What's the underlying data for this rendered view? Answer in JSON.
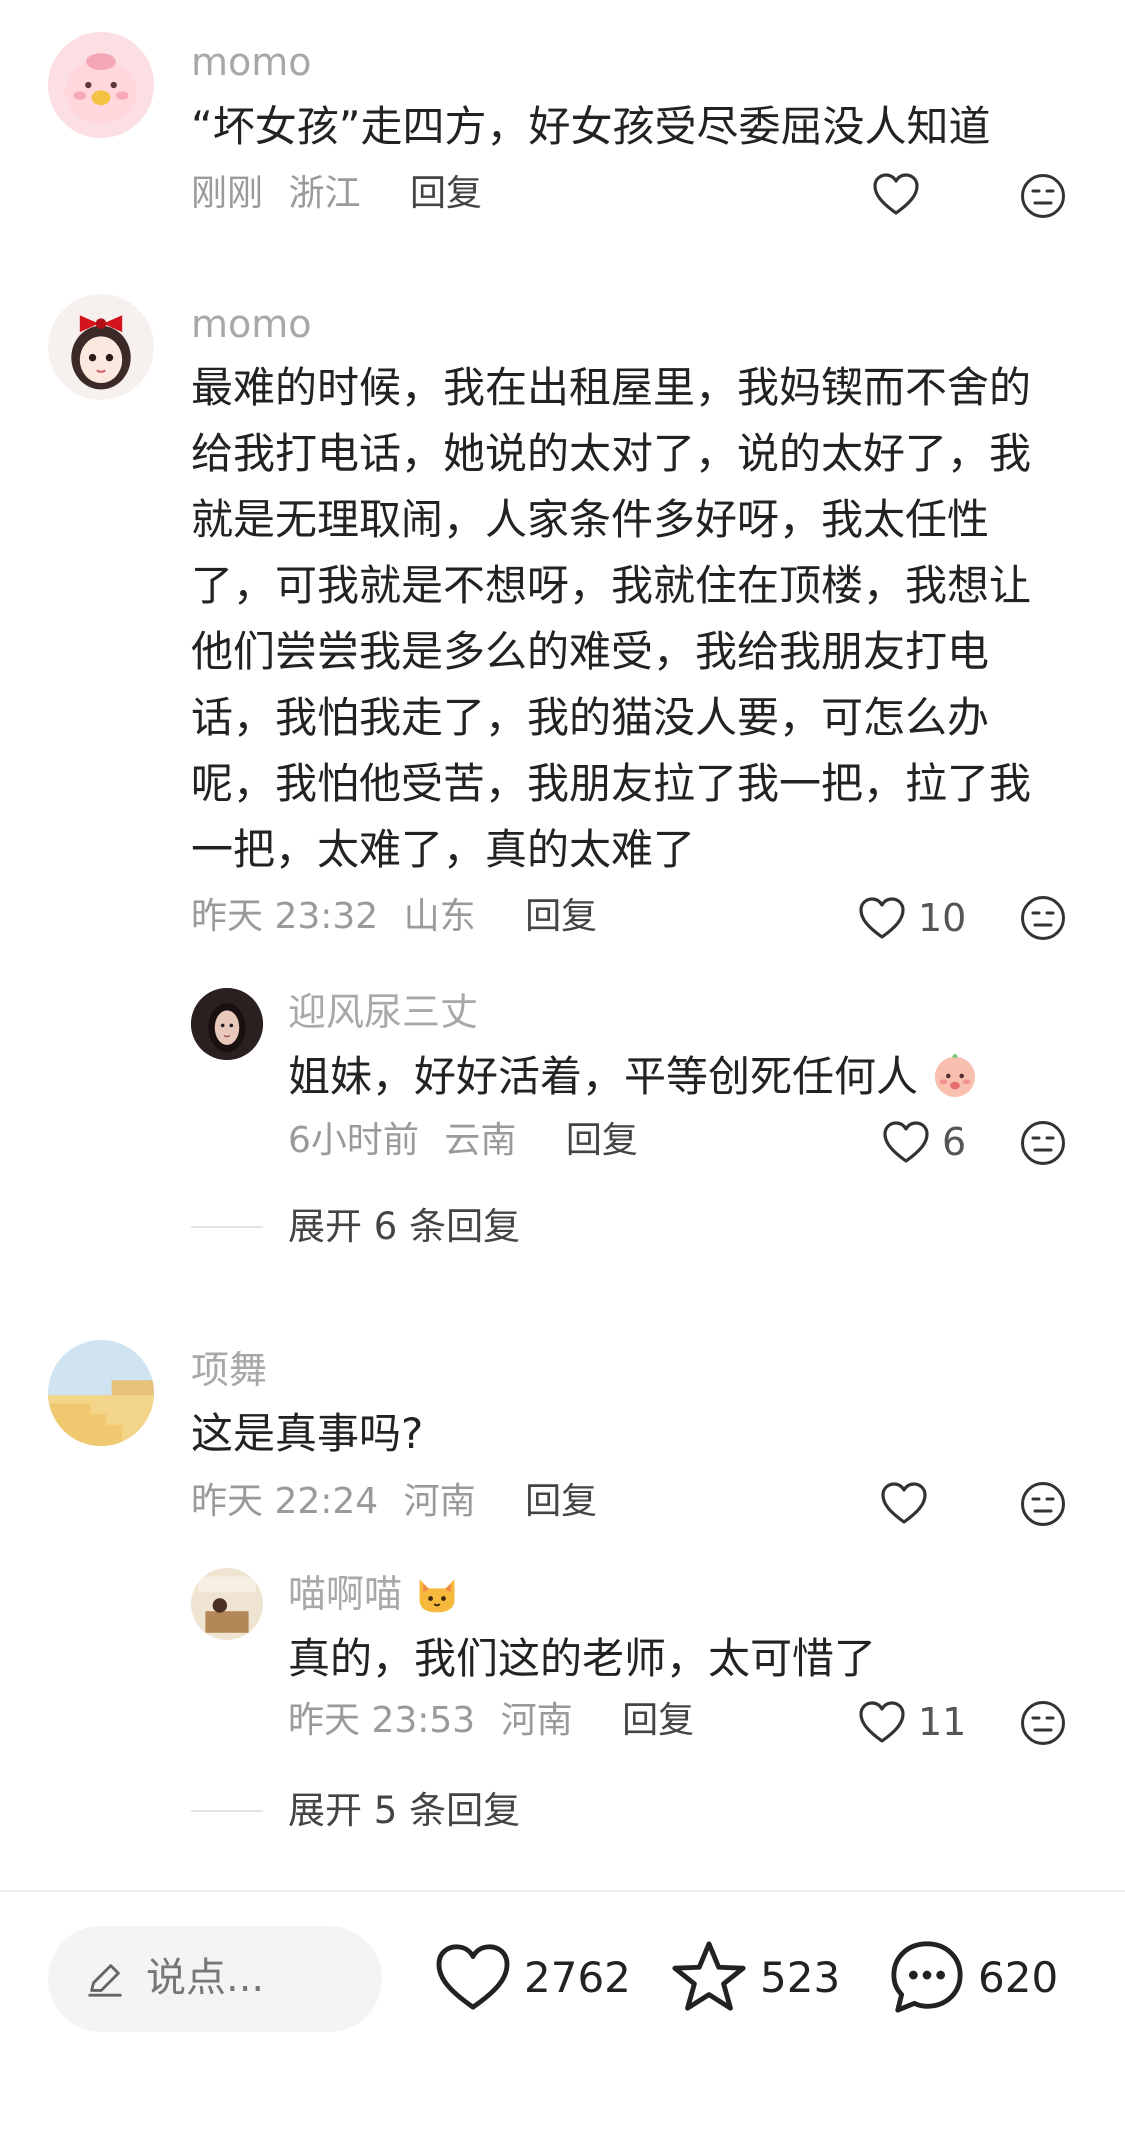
{
  "comments": [
    {
      "username": "momo",
      "text": "“坏女孩”走四方，好女孩受尽委屈没人知道",
      "time": "刚刚",
      "location": "浙江",
      "reply_label": "回复",
      "likes": ""
    },
    {
      "username": "momo",
      "text": "最难的时候，我在出租屋里，我妈锲而不舍的给我打电话，她说的太对了，说的太好了，我就是无理取闹，人家条件多好呀，我太任性了，可我就是不想呀，我就住在顶楼，我想让他们尝尝我是多么的难受，我给我朋友打电话，我怕我走了，我的猫没人要，可怎么办呢，我怕他受苦，我朋友拉了我一把，拉了我一把，太难了，真的太难了",
      "time": "昨天 23:32",
      "location": "山东",
      "reply_label": "回复",
      "likes": "10",
      "reply": {
        "username": "迎风尿三丈",
        "text": "姐妹，好好活着，平等创死任何人",
        "time": "6小时前",
        "location": "云南",
        "reply_label": "回复",
        "likes": "6"
      },
      "expand_label": "展开 6 条回复"
    },
    {
      "username": "项舞",
      "text": "这是真事吗?",
      "time": "昨天 22:24",
      "location": "河南",
      "reply_label": "回复",
      "likes": "",
      "reply": {
        "username": "喵啊喵",
        "text": "真的，我们这的老师，太可惜了",
        "time": "昨天 23:53",
        "location": "河南",
        "reply_label": "回复",
        "likes": "11"
      },
      "expand_label": "展开 5 条回复"
    }
  ],
  "bottom_bar": {
    "input_placeholder": "说点...",
    "likes": "2762",
    "favorites": "523",
    "comments": "620"
  },
  "icons": [
    "heart-icon",
    "meh-face-icon",
    "pencil-icon",
    "star-icon",
    "chat-bubble-icon",
    "baby-emoji-icon",
    "cat-emoji-icon"
  ],
  "colors": {
    "secondary_text": "#a8a8a8",
    "primary_text": "#222222",
    "divider": "#ececec"
  }
}
